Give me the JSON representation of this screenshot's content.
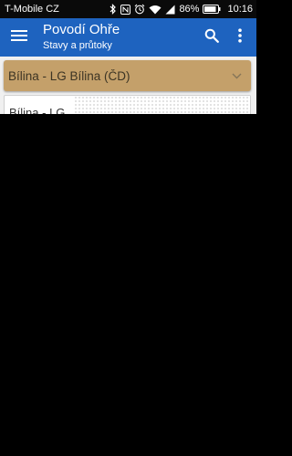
{
  "status_bar": {
    "carrier": "T-Mobile CZ",
    "battery_percent": "86%",
    "time": "10:16",
    "icons": [
      "bluetooth-icon",
      "nfc-icon",
      "alarm-icon",
      "wifi-icon",
      "signal-icon",
      "battery-icon"
    ]
  },
  "app_bar": {
    "title": "Povodí Ohře",
    "subtitle": "Stavy a průtoky",
    "background_color": "#1e63bf",
    "icons": [
      "menu-icon",
      "search-icon",
      "more-vert-icon"
    ]
  },
  "station_selector": {
    "selected": "Bílina - LG Bílina (ČD)",
    "background_color": "#c4a06a",
    "icon": "chevron-down-icon"
  },
  "station_card": {
    "title_partial": "Bílina - LG"
  }
}
